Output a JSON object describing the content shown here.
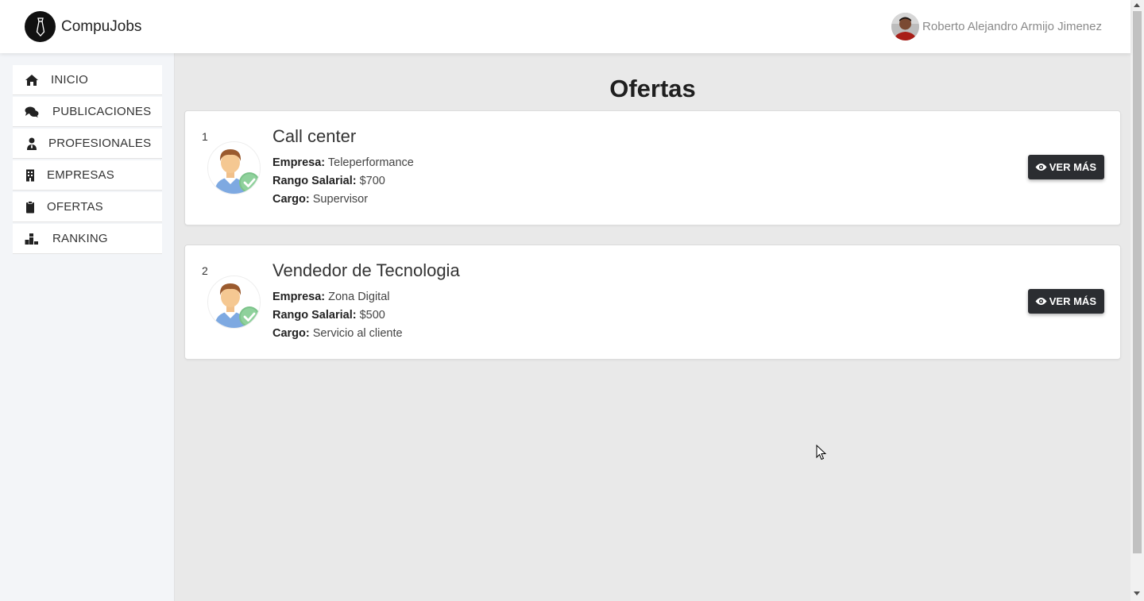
{
  "app": {
    "name": "CompuJobs"
  },
  "user": {
    "name": "Roberto Alejandro Armijo Jimenez"
  },
  "sidebar": {
    "items": [
      {
        "label": "INICIO",
        "icon": "home-icon"
      },
      {
        "label": "PUBLICACIONES",
        "icon": "comments-icon"
      },
      {
        "label": "PROFESIONALES",
        "icon": "user-tie-icon"
      },
      {
        "label": "EMPRESAS",
        "icon": "building-icon"
      },
      {
        "label": "OFERTAS",
        "icon": "clipboard-icon"
      },
      {
        "label": "RANKING",
        "icon": "ranking-icon"
      }
    ]
  },
  "main": {
    "title": "Ofertas",
    "labels": {
      "empresa": "Empresa:",
      "rango": "Rango Salarial:",
      "cargo": "Cargo:"
    },
    "offers": [
      {
        "index": "1",
        "title": "Call center",
        "empresa": "Teleperformance",
        "rango": "$700",
        "cargo": "Supervisor",
        "button": "VER MÁS"
      },
      {
        "index": "2",
        "title": "Vendedor de Tecnologia",
        "empresa": "Zona Digital",
        "rango": "$500",
        "cargo": "Servicio al cliente",
        "button": "VER MÁS"
      }
    ]
  },
  "colors": {
    "accent": "#2b2d31",
    "background": "#e9e9e9",
    "sidebar": "#f3f5f8"
  }
}
